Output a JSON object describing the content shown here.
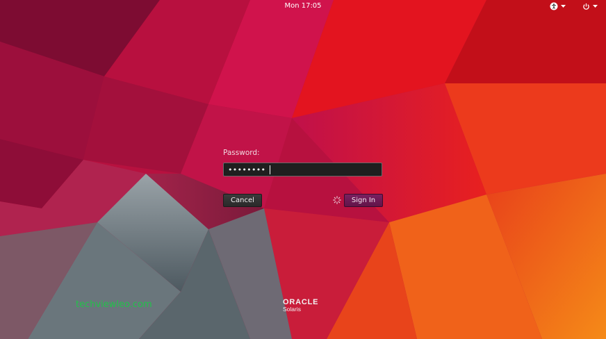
{
  "topbar": {
    "clock": "Mon 17:05",
    "accessibility_icon": "accessibility-icon",
    "power_icon": "power-icon"
  },
  "login": {
    "password_label": "Password:",
    "password_value": "••••••••",
    "cancel_label": "Cancel",
    "signin_label": "Sign In",
    "spinner_icon": "gear-spinner-icon"
  },
  "branding": {
    "watermark": "techviewleo.com",
    "brand": "ORACLE",
    "product": "Solaris"
  },
  "colors": {
    "signin_accent": "#6a184f",
    "watermark": "#22c24a"
  }
}
